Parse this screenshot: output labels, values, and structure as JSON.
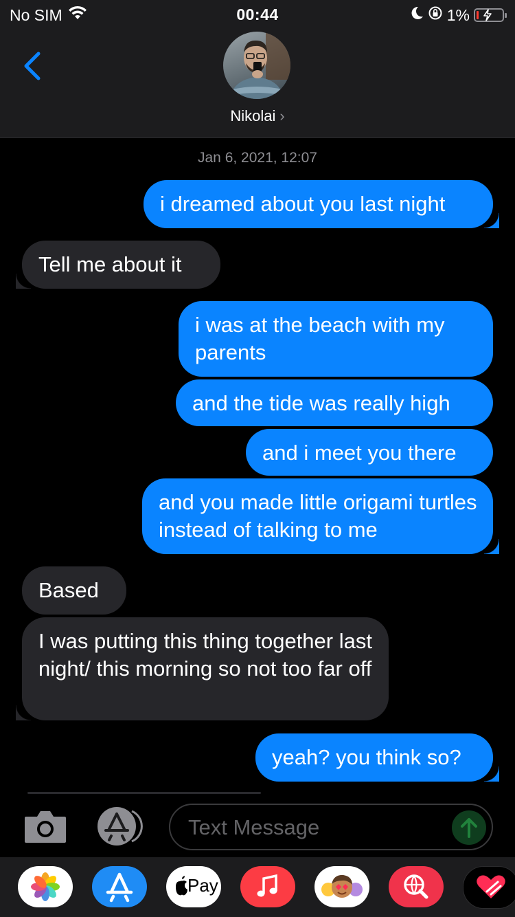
{
  "status": {
    "carrier": "No SIM",
    "time": "00:44",
    "battery_percent": "1%",
    "battery_level": 0.01,
    "icons": [
      "wifi-icon",
      "moon-icon",
      "orientation-lock-icon",
      "battery-charging-icon"
    ]
  },
  "contact": {
    "name": "Nikolai",
    "chevron": "›"
  },
  "thread": {
    "timestamp": "Jan 6, 2021, 12:07",
    "messages": [
      {
        "from": "me",
        "text": "i dreamed about you last night"
      },
      {
        "from": "them",
        "text": "Tell me about it"
      },
      {
        "from": "me",
        "text": "i was at the beach with my parents"
      },
      {
        "from": "me",
        "text": "and the tide was really high"
      },
      {
        "from": "me",
        "text": "and i meet you there"
      },
      {
        "from": "me",
        "text": "and you made little origami turtles instead of talking to me"
      },
      {
        "from": "them",
        "text": "Based"
      },
      {
        "from": "them",
        "text": "I was putting this thing together last night/ this morning so not too far off"
      },
      {
        "from": "me",
        "text": "yeah? you think so?"
      }
    ]
  },
  "compose": {
    "placeholder": "Text Message"
  },
  "drawer": {
    "apps": [
      "photos-app-icon",
      "app-store-app-icon",
      "apple-pay-app-icon",
      "music-app-icon",
      "memoji-app-icon",
      "web-search-app-icon",
      "digital-touch-app-icon"
    ],
    "apple_pay_label": "Pay"
  },
  "colors": {
    "outgoing_bubble": "#0a84ff",
    "incoming_bubble": "#26262a",
    "header": "#1c1c1e",
    "accent": "#0a84ff"
  }
}
